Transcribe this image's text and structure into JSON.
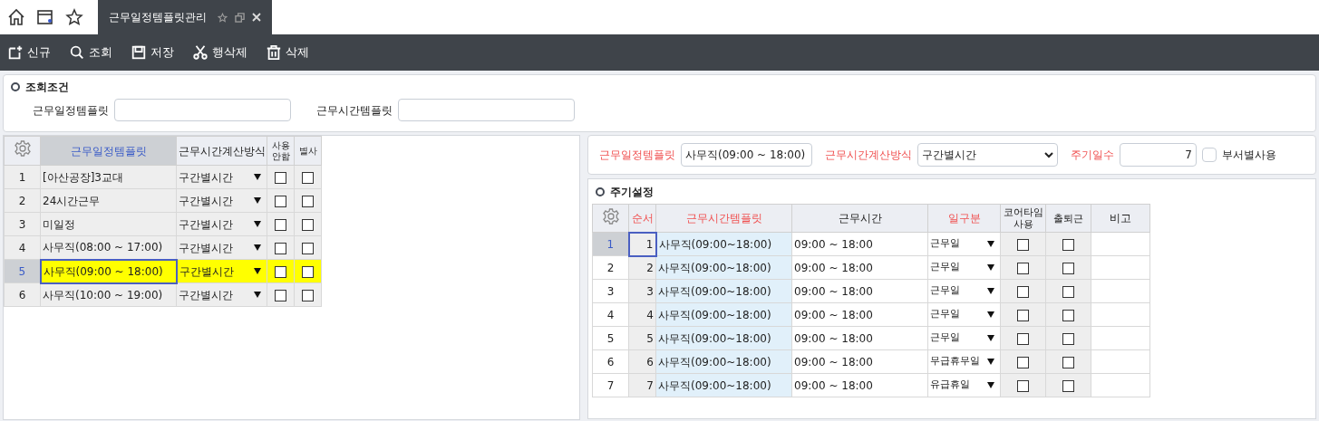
{
  "tabs": [
    {
      "label": "근무일정템플릿관리",
      "selected": true
    }
  ],
  "toolbar": [
    {
      "kind": "new",
      "label": "신규"
    },
    {
      "kind": "search",
      "label": "조회"
    },
    {
      "kind": "save",
      "label": "저장"
    },
    {
      "kind": "cut",
      "label": "행삭제"
    },
    {
      "kind": "delete",
      "label": "삭제"
    }
  ],
  "search_panel": {
    "title": "조회조건",
    "fields": [
      {
        "label": "근무일정템플릿"
      },
      {
        "label": "근무시간템플릿"
      }
    ]
  },
  "left_grid": {
    "columns": [
      "근무일정템플릿",
      "근무시간계산방식",
      "사용안함",
      "별사"
    ],
    "rows": [
      {
        "no": "1",
        "name": "[아산공장]3교대",
        "method": "구간별시간",
        "unused": false,
        "dept": false,
        "selected": false
      },
      {
        "no": "2",
        "name": "24시간근무",
        "method": "구간별시간",
        "unused": false,
        "dept": false,
        "selected": false
      },
      {
        "no": "3",
        "name": "미일정",
        "method": "구간별시간",
        "unused": false,
        "dept": false,
        "selected": false
      },
      {
        "no": "4",
        "name": "사무직(08:00 ~ 17:00)",
        "method": "구간별시간",
        "unused": false,
        "dept": false,
        "selected": false
      },
      {
        "no": "5",
        "name": "사무직(09:00 ~ 18:00)",
        "method": "구간별시간",
        "unused": false,
        "dept": false,
        "selected": true
      },
      {
        "no": "6",
        "name": "사무직(10:00 ~ 19:00)",
        "method": "구간별시간",
        "unused": false,
        "dept": false,
        "selected": false
      }
    ]
  },
  "detail_form": {
    "template_label": "근무일정템플릿",
    "template_value": "사무직(09:00 ~ 18:00)",
    "method_label": "근무시간계산방식",
    "method_value": "구간별시간",
    "cycle_label": "주기일수",
    "cycle_value": "7",
    "dept_label": "부서별사용",
    "dept_checked": false
  },
  "cycle_section": {
    "title": "주기설정",
    "columns": [
      "순서",
      "근무시간템플릿",
      "근무시간",
      "일구분",
      "코어타임사용",
      "출퇴근",
      "비고"
    ],
    "rows": [
      {
        "no": "1",
        "order": "1",
        "template": "사무직(09:00~18:00)",
        "time": "09:00 ~ 18:00",
        "day_type": "근무일",
        "core": false,
        "attend": false,
        "selected": true
      },
      {
        "no": "2",
        "order": "2",
        "template": "사무직(09:00~18:00)",
        "time": "09:00 ~ 18:00",
        "day_type": "근무일",
        "core": false,
        "attend": false,
        "selected": false
      },
      {
        "no": "3",
        "order": "3",
        "template": "사무직(09:00~18:00)",
        "time": "09:00 ~ 18:00",
        "day_type": "근무일",
        "core": false,
        "attend": false,
        "selected": false
      },
      {
        "no": "4",
        "order": "4",
        "template": "사무직(09:00~18:00)",
        "time": "09:00 ~ 18:00",
        "day_type": "근무일",
        "core": false,
        "attend": false,
        "selected": false
      },
      {
        "no": "5",
        "order": "5",
        "template": "사무직(09:00~18:00)",
        "time": "09:00 ~ 18:00",
        "day_type": "근무일",
        "core": false,
        "attend": false,
        "selected": false
      },
      {
        "no": "6",
        "order": "6",
        "template": "사무직(09:00~18:00)",
        "time": "09:00 ~ 18:00",
        "day_type": "무급휴무일",
        "core": false,
        "attend": false,
        "selected": false
      },
      {
        "no": "7",
        "order": "7",
        "template": "사무직(09:00~18:00)",
        "time": "09:00 ~ 18:00",
        "day_type": "유급휴일",
        "core": false,
        "attend": false,
        "selected": false
      }
    ]
  }
}
